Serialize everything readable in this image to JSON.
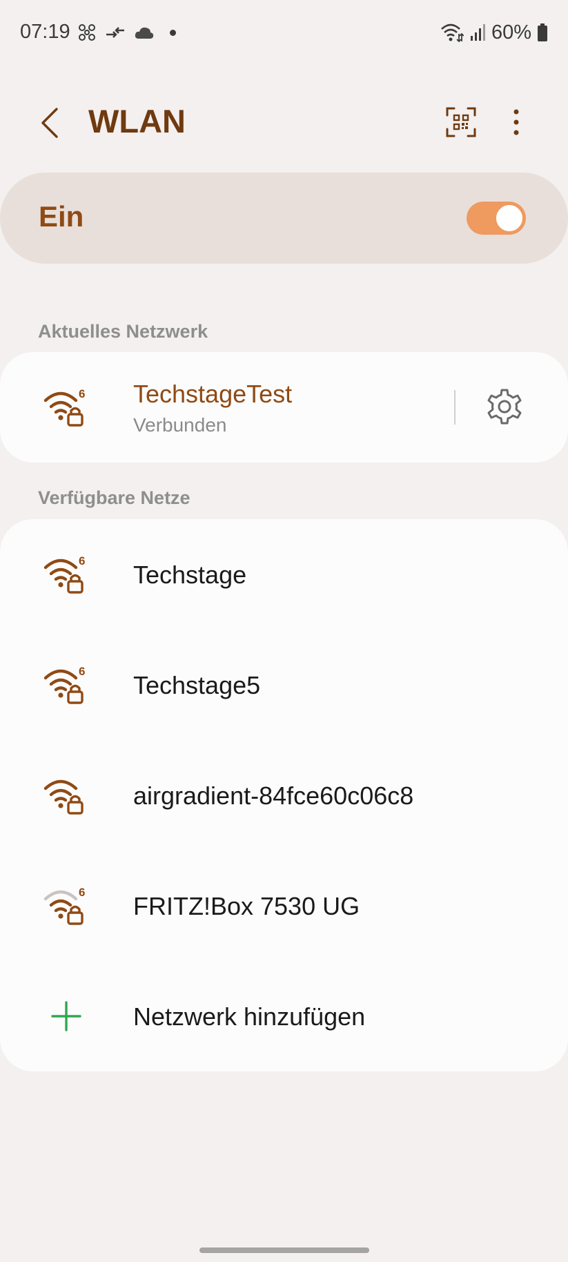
{
  "status_bar": {
    "time": "07:19",
    "battery": "60%"
  },
  "header": {
    "title": "WLAN"
  },
  "master_switch": {
    "label": "Ein",
    "state": "on"
  },
  "current_section": {
    "label": "Aktuelles Netzwerk",
    "network": {
      "name": "TechstageTest",
      "status": "Verbunden"
    }
  },
  "available_section": {
    "label": "Verfügbare Netze",
    "networks": [
      {
        "name": "Techstage",
        "wifi6": true
      },
      {
        "name": "Techstage5",
        "wifi6": true
      },
      {
        "name": "airgradient-84fce60c06c8",
        "wifi6": false
      },
      {
        "name": "FRITZ!Box 7530 UG",
        "wifi6": true
      }
    ],
    "add_label": "Netzwerk hinzufügen"
  },
  "colors": {
    "accent": "#8f4a15",
    "toggle": "#ef9a5f",
    "add_icon": "#2ea84f"
  }
}
